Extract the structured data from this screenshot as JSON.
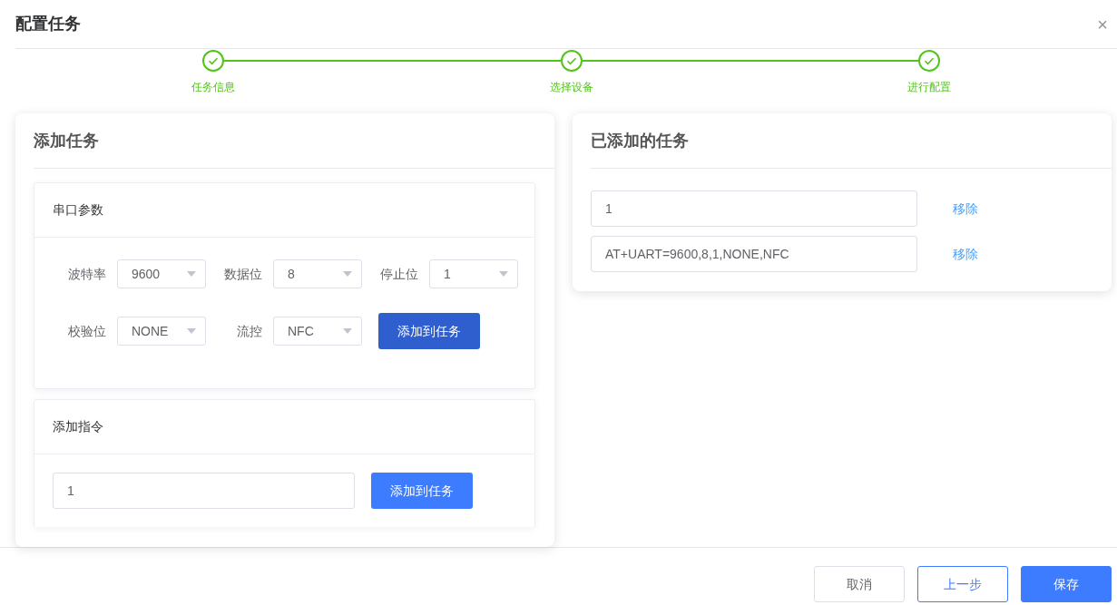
{
  "dialog": {
    "title": "配置任务",
    "close": "×"
  },
  "steps": [
    {
      "label": "任务信息",
      "done": true
    },
    {
      "label": "选择设备",
      "done": true
    },
    {
      "label": "进行配置",
      "done": true
    }
  ],
  "add_task": {
    "title": "添加任务",
    "serial_params": {
      "title": "串口参数",
      "fields": [
        {
          "label": "波特率",
          "value": "9600"
        },
        {
          "label": "数据位",
          "value": "8"
        },
        {
          "label": "停止位",
          "value": "1"
        },
        {
          "label": "校验位",
          "value": "NONE"
        },
        {
          "label": "流控",
          "value": "NFC"
        }
      ],
      "button": "添加到任务"
    },
    "command": {
      "title": "添加指令",
      "value": "1",
      "button": "添加到任务"
    }
  },
  "added_tasks": {
    "title": "已添加的任务",
    "items": [
      {
        "value": "1",
        "action": "移除"
      },
      {
        "value": "AT+UART=9600,8,1,NONE,NFC",
        "action": "移除"
      }
    ]
  },
  "footer": {
    "buttons": [
      {
        "label": "取消",
        "kind": "default"
      },
      {
        "label": "上一步",
        "kind": "outline"
      },
      {
        "label": "保存",
        "kind": "primary"
      }
    ]
  }
}
